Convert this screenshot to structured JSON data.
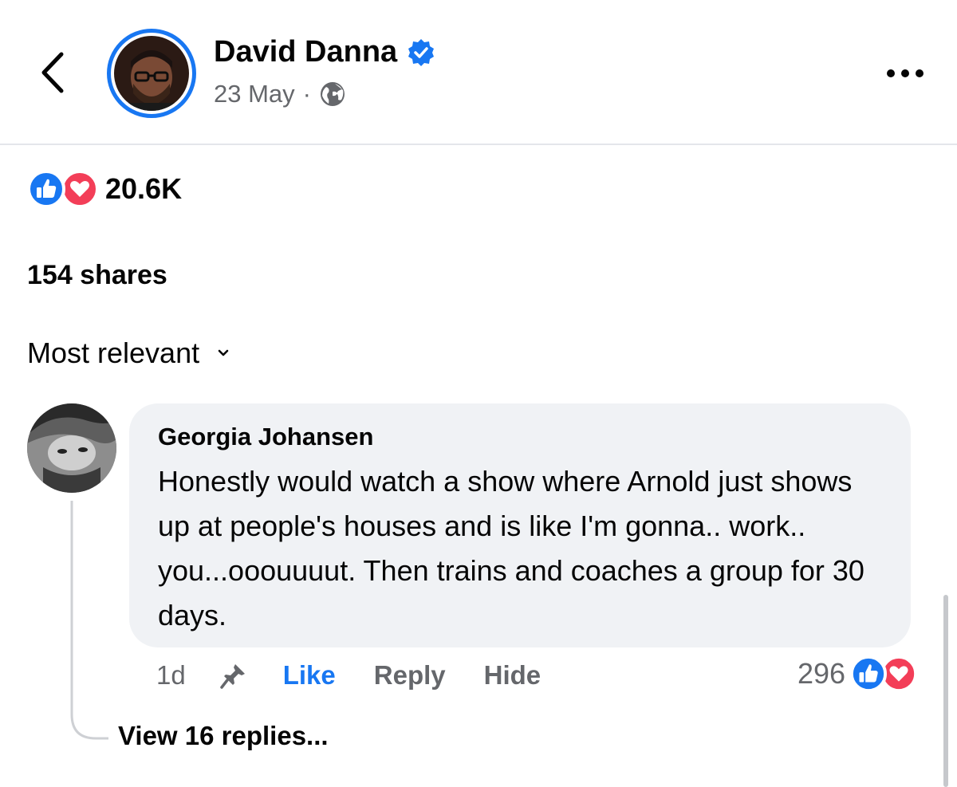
{
  "header": {
    "author_name": "David Danna",
    "post_date": "23 May",
    "separator": "·",
    "verified": true,
    "audience_icon": "globe-icon"
  },
  "stats": {
    "reaction_count": "20.6K",
    "reaction_icons": [
      "like-icon",
      "love-icon"
    ],
    "shares": "154 shares"
  },
  "sort": {
    "label": "Most relevant"
  },
  "comment": {
    "author": "Georgia Johansen",
    "text": "Honestly would watch a show where Arnold just shows up at people's houses and is like I'm gonna.. work.. you...ooouuuut. Then trains and coaches a group for 30 days.",
    "time": "1d",
    "like_label": "Like",
    "reply_label": "Reply",
    "hide_label": "Hide",
    "reaction_count": "296",
    "view_replies": "View 16 replies..."
  },
  "colors": {
    "accent": "#1877F2",
    "love": "#F33E58",
    "secondary_text": "#65676B",
    "bubble": "#F0F2F5"
  }
}
